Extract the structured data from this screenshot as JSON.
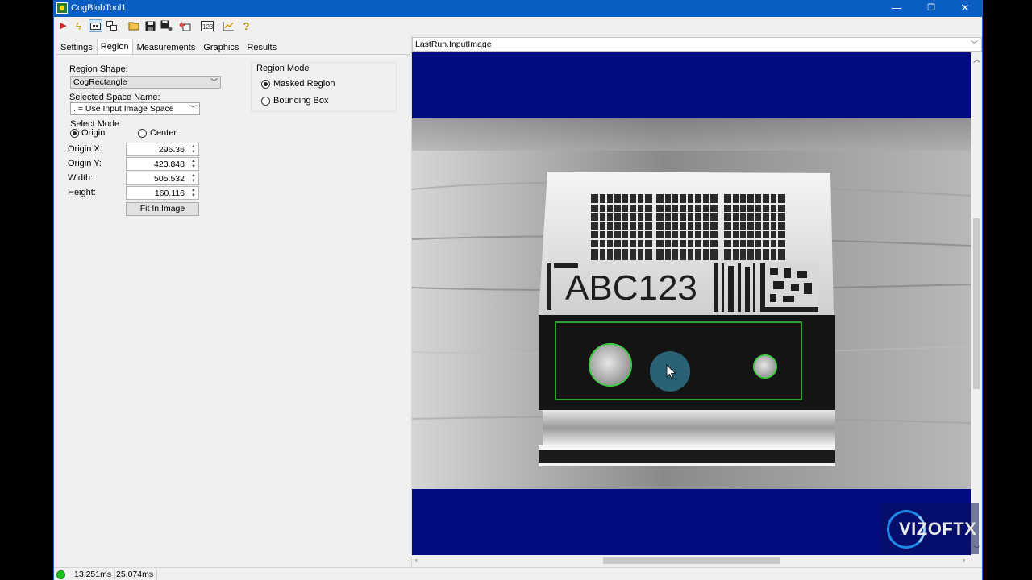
{
  "window": {
    "title": "CogBlobTool1",
    "controls": {
      "minimize": "—",
      "restore": "❐",
      "close": "✕"
    }
  },
  "toolbar": {
    "icons": [
      "run-icon",
      "electric-icon",
      "link-icon",
      "tool-icon",
      "open-icon",
      "save-icon",
      "save-settings-icon",
      "reset-icon",
      "count-icon",
      "graph-icon",
      "help-icon"
    ]
  },
  "tabs": [
    "Settings",
    "Region",
    "Measurements",
    "Graphics",
    "Results"
  ],
  "region": {
    "shape_label": "Region Shape:",
    "shape_value": "CogRectangle",
    "space_label": "Selected Space Name:",
    "space_value": ". = Use Input Image Space",
    "select_mode_label": "Select Mode",
    "mode_origin": "Origin",
    "mode_center": "Center",
    "fields": [
      {
        "label": "Origin X:",
        "value": "296.36"
      },
      {
        "label": "Origin Y:",
        "value": "423.848"
      },
      {
        "label": "Width:",
        "value": "505.532"
      },
      {
        "label": "Height:",
        "value": "160.116"
      }
    ],
    "fit_button": "Fit In Image",
    "region_mode_label": "Region Mode",
    "masked_region": "Masked Region",
    "bounding_box": "Bounding Box"
  },
  "display": {
    "header": "LastRun.InputImage",
    "part_text": "ABC123",
    "background_color": "#020b80",
    "region_color": "#35d13a"
  },
  "status": {
    "time1": "13.251ms",
    "time2": "25.074ms",
    "ok_color": "#19c219"
  },
  "watermark": "VIZOFTX"
}
